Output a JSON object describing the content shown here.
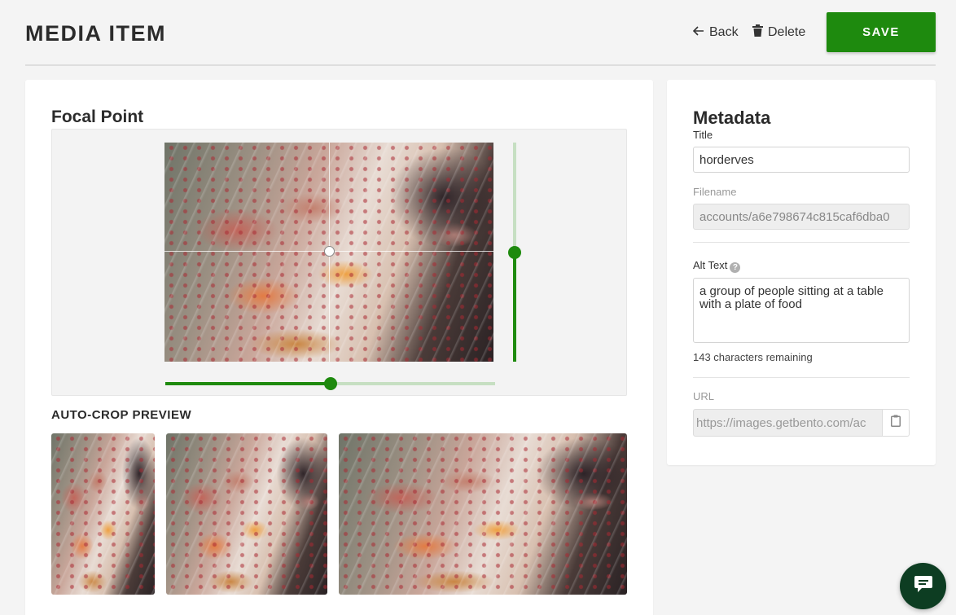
{
  "header": {
    "title": "MEDIA ITEM",
    "back_label": "Back",
    "delete_label": "Delete",
    "save_label": "SAVE"
  },
  "focal_point": {
    "title": "Focal Point",
    "image_alt": "a group of people sitting at a table with a plate of food",
    "horizontal_value": 0.5,
    "vertical_value": 0.5
  },
  "auto_crop": {
    "title": "AUTO-CROP PREVIEW",
    "previews": [
      "portrait-narrow",
      "portrait",
      "landscape"
    ]
  },
  "metadata": {
    "title": "Metadata",
    "title_label": "Title",
    "title_value": "horderves",
    "filename_label": "Filename",
    "filename_value": "accounts/a6e798674c815caf6dba0",
    "alt_text_label": "Alt Text",
    "alt_text_value": "a group of people sitting at a table with a plate of food",
    "chars_remaining": "143 characters remaining",
    "url_label": "URL",
    "url_value": "https://images.getbento.com/ac"
  },
  "colors": {
    "accent": "#1e8a0e",
    "slider_track": "#c6dfc2",
    "chat_button": "#0d3d22"
  },
  "icons": {
    "back": "arrow-left-icon",
    "delete": "trash-icon",
    "help": "question-icon",
    "copy": "clipboard-icon",
    "chat": "chat-bubble-icon"
  }
}
